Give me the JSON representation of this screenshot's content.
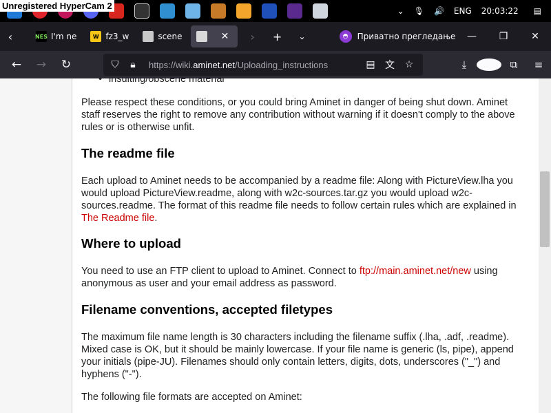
{
  "overlay": {
    "hypercam_text": "Unregistered HyperCam 2"
  },
  "taskbar": {
    "icons": [
      "app-icon-edge",
      "app-icon-opera",
      "app-icon-discord",
      "app-icon-acrobat",
      "app-icon-clapper",
      "app-icon-paint",
      "app-icon-notepad",
      "app-icon-film",
      "app-icon-player",
      "app-icon-save",
      "app-icon-private",
      "app-icon-game"
    ],
    "language": "ENG",
    "time": "20:03:22"
  },
  "tabs": {
    "items": [
      {
        "label": "I'm ne",
        "favicon_text": "NES"
      },
      {
        "label": "fz3_w",
        "favicon_text": "W"
      },
      {
        "label": "scene",
        "favicon_text": ""
      },
      {
        "label": "",
        "favicon_text": ""
      }
    ],
    "private_label": "Приватно прегледање"
  },
  "navbar": {
    "url_prefix": "https://wiki.",
    "url_domain": "aminet.net",
    "url_path": "/Uploading_instructions"
  },
  "article": {
    "bullet_cut": "insulting/obscene material",
    "p1": "Please respect these conditions, or you could bring Aminet in danger of being shut down. Aminet staff reserves the right to remove any contribution without warning if it doesn't comply to the above rules or is otherwise unfit.",
    "h_readme": "The readme file",
    "p2_text": "Each upload to Aminet needs to be accompanied by a readme file: Along with PictureView.lha you would upload PictureView.readme, along with w2c-sources.tar.gz you would upload w2c-sources.readme. The format of this readme file needs to follow certain rules which are explained in ",
    "p2_link": "The Readme file",
    "p2_end": ".",
    "h_where": "Where to upload",
    "p3_text": "You need to use an FTP client to upload to Aminet. Connect to ",
    "p3_link": "ftp://main.aminet.net/new",
    "p3_end": " using anonymous as user and your email address as password.",
    "h_filename": "Filename conventions, accepted filetypes",
    "p4": "The maximum file name length is 30 characters including the filename suffix (.lha, .adf, .readme). Mixed case is OK, but it should be mainly lowercase. If your file name is generic (ls, pipe), append your initials (pipe-JU). Filenames should only contain letters, digits, dots, underscores (\"_\") and hyphens (\"-\").",
    "p5": "The following file formats are accepted on Aminet:"
  }
}
